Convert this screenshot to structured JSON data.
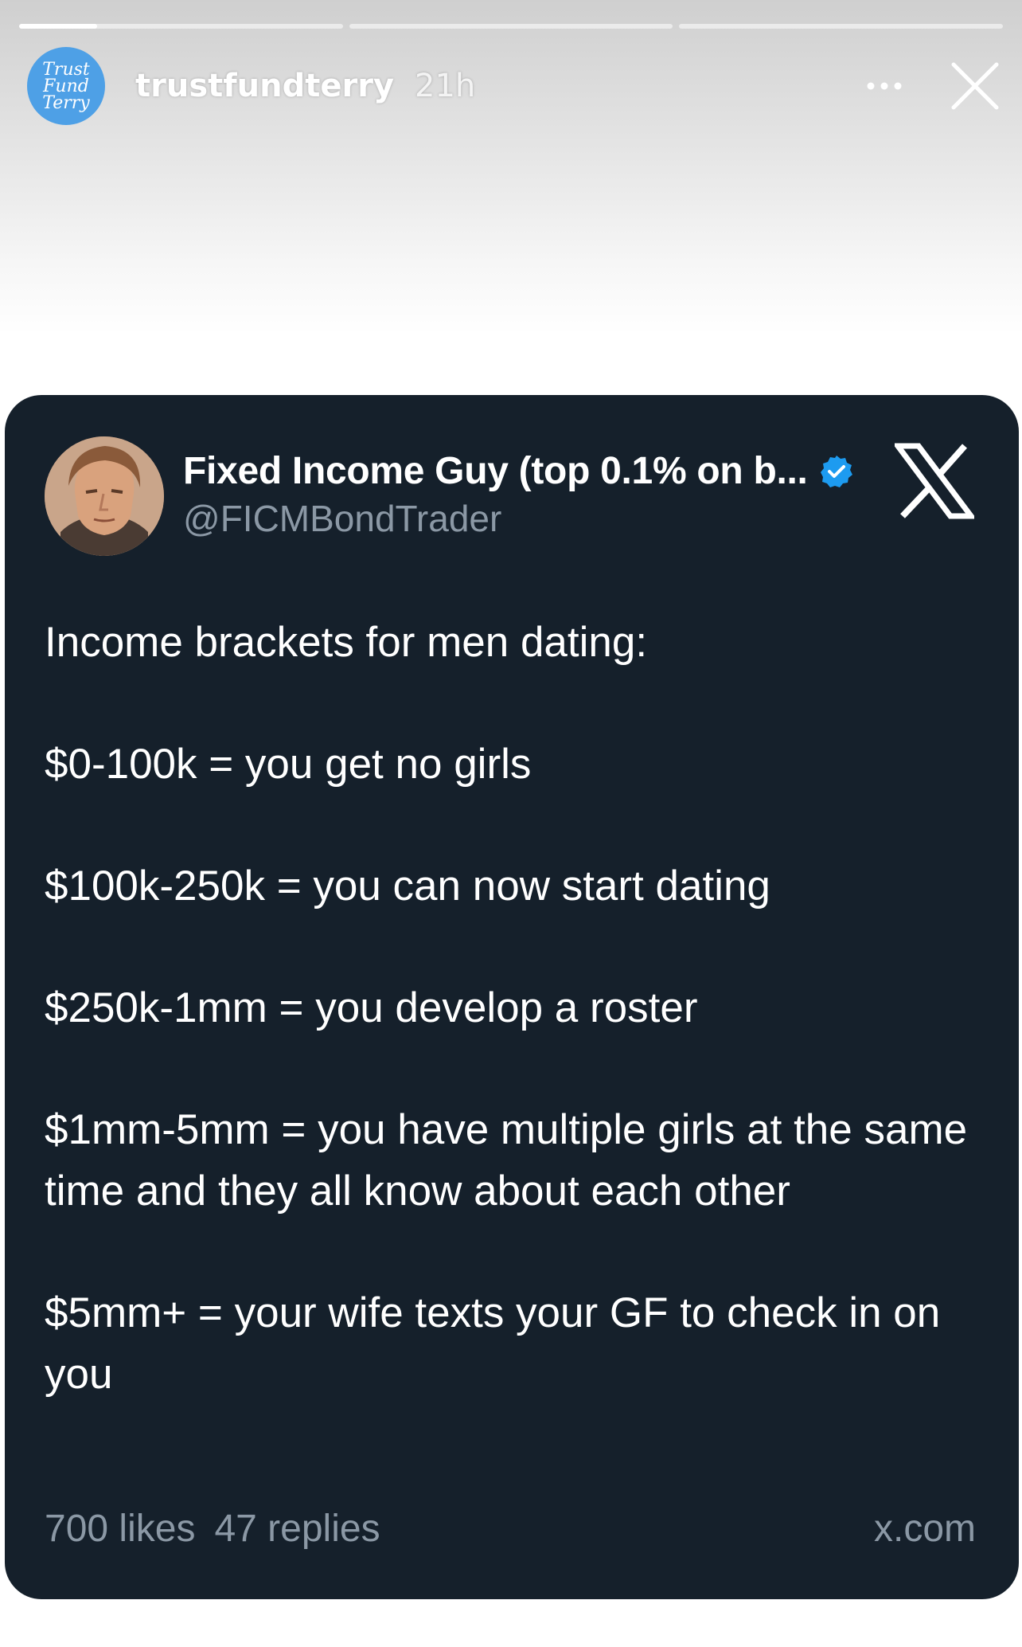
{
  "story": {
    "progress_segments": [
      0.24,
      0,
      0
    ],
    "username": "trustfundterry",
    "time_ago": "21h",
    "avatar_logo_lines": [
      "Trust",
      "Fund",
      "Terry"
    ],
    "icons": {
      "more": "more-horizontal-icon",
      "close": "close-icon"
    }
  },
  "tweet": {
    "display_name": "Fixed Income Guy (top 0.1% on b...",
    "handle": "@FICMBondTrader",
    "verified": true,
    "verified_color": "#1d9bf0",
    "platform_icon": "x-logo-icon",
    "paragraphs": [
      "Income brackets for men dating:",
      "$0-100k = you get no girls",
      "$100k-250k = you can now start dating",
      "$250k-1mm = you develop a roster",
      "$1mm-5mm = you have multiple girls at the same time and they all know about each other",
      "$5mm+ = your wife texts your GF to check in on you"
    ],
    "likes": "700 likes",
    "replies": "47 replies",
    "source": "x.com"
  },
  "colors": {
    "card_background": "#15202b",
    "secondary_text": "#8b98a5",
    "avatar_blue": "#4ea0e6"
  }
}
